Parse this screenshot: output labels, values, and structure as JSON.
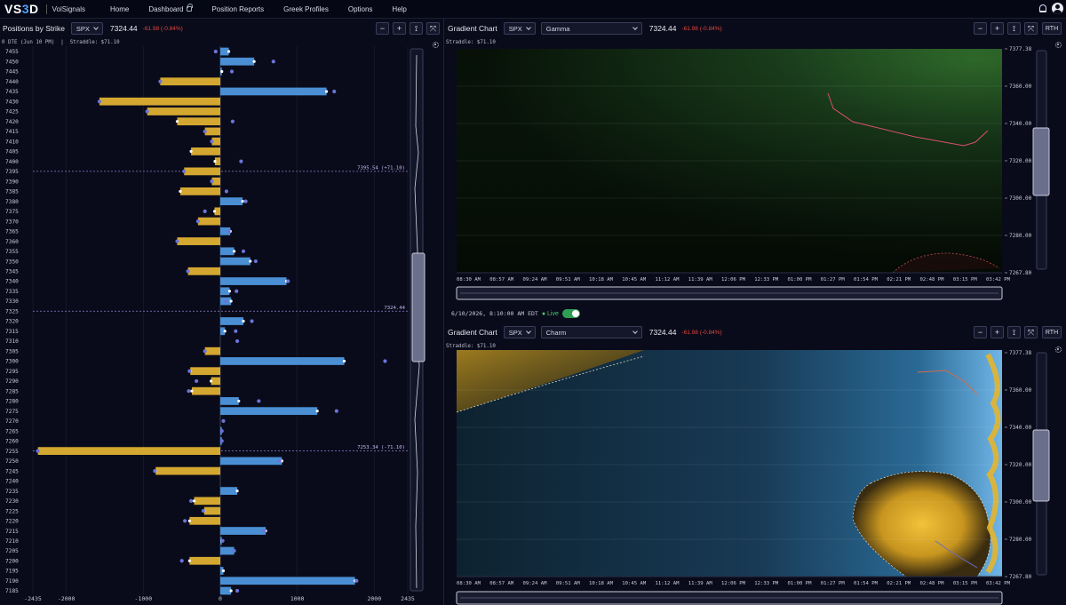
{
  "nav": {
    "logo_prefix": "VS",
    "logo_accent": "3",
    "logo_suffix": "D",
    "brand": "VolSignals",
    "links": [
      "Home",
      "Dashboard",
      "Position Reports",
      "Greek Profiles",
      "Options",
      "Help"
    ]
  },
  "left_panel": {
    "title": "Positions by Strike",
    "symbol": "SPX",
    "price": "7324.44",
    "change": "-61.98 (-0.84%)",
    "subtitle": "0 DTE (Jun 10 PM)  |  Straddle: $71.10",
    "buttons": [
      "−",
      "+",
      "⟟",
      "⤧"
    ]
  },
  "chart_data": {
    "type": "bar",
    "title": "",
    "x_ticks": [
      -2435,
      -2000,
      -1000,
      0,
      1000,
      2000,
      2435
    ],
    "xlim": [
      -2435,
      2435
    ],
    "ylim": [
      7185,
      7455
    ],
    "strike_step": 5,
    "annotations": [
      {
        "strike": 7395,
        "label": "7395.54 (+71.10)"
      },
      {
        "strike": 7325,
        "label": "7324.44"
      },
      {
        "strike": 7255,
        "label": "7253.34 (-71.10)"
      }
    ],
    "series": [
      {
        "name": "",
        "color": "#d4a830",
        "values": {
          "7440": -780,
          "7430": -1570,
          "7425": -950,
          "7420": -560,
          "7415": -200,
          "7410": -110,
          "7405": -380,
          "7400": -70,
          "7395": -470,
          "7390": -110,
          "7385": -520,
          "7375": -75,
          "7370": -290,
          "7360": -560,
          "7345": -420,
          "7305": -200,
          "7295": -390,
          "7290": -120,
          "7285": -370,
          "7255": -2370,
          "7245": -840,
          "7230": -340,
          "7225": -210,
          "7220": -400,
          "7200": -400
        }
      },
      {
        "name": "",
        "color": "#4a8fd4",
        "values": {
          "7455": 110,
          "7450": 440,
          "7445": 20,
          "7435": 1380,
          "7380": 290,
          "7365": 130,
          "7355": 180,
          "7350": 390,
          "7340": 860,
          "7335": 120,
          "7330": 140,
          "7320": 300,
          "7315": 60,
          "7300": 1610,
          "7280": 240,
          "7275": 1260,
          "7265": 20,
          "7260": 20,
          "7250": 800,
          "7235": 220,
          "7215": 590,
          "7210": 20,
          "7205": 180,
          "7195": 40,
          "7190": 1750,
          "7185": 140
        }
      }
    ],
    "dots": {
      "7455": -60,
      "7450": 690,
      "7445": 150,
      "7440": -780,
      "7435": 1480,
      "7430": -1570,
      "7425": -950,
      "7420": 160,
      "7415": -200,
      "7410": -110,
      "7400": 270,
      "7395": -470,
      "7390": -110,
      "7385": 80,
      "7380": 330,
      "7375": -200,
      "7370": -290,
      "7365": 110,
      "7360": -560,
      "7355": 300,
      "7350": 460,
      "7345": -420,
      "7340": 880,
      "7335": 210,
      "7330": 70,
      "7320": 410,
      "7315": 200,
      "7310": 220,
      "7305": -200,
      "7300": 2140,
      "7295": -400,
      "7290": -310,
      "7285": -410,
      "7280": 500,
      "7275": 1510,
      "7270": 40,
      "7265": 20,
      "7260": 20,
      "7255": -2370,
      "7250": 770,
      "7245": -850,
      "7230": -380,
      "7225": -220,
      "7220": -460,
      "7215": 570,
      "7210": 30,
      "7205": 180,
      "7200": -500,
      "7190": 1770,
      "7185": 220
    }
  },
  "gamma_panel": {
    "title": "Gradient Chart",
    "symbol": "SPX",
    "metric": "Gamma",
    "price": "7324.44",
    "change": "-61.98 (-0.84%)",
    "subtitle": "Straddle: $71.10",
    "rth": "RTH",
    "y_ticks": [
      "7377.38",
      "7360.00",
      "7340.00",
      "7320.00",
      "7300.00",
      "7280.00",
      "7267.80"
    ],
    "x_ticks": [
      "08:30 AM",
      "08:57 AM",
      "09:24 AM",
      "09:51 AM",
      "10:18 AM",
      "10:45 AM",
      "11:12 AM",
      "11:39 AM",
      "12:06 PM",
      "12:33 PM",
      "01:00 PM",
      "01:27 PM",
      "01:54 PM",
      "02:21 PM",
      "02:48 PM",
      "03:15 PM",
      "03:42 PM"
    ]
  },
  "status": {
    "timestamp": "6/10/2026, 8:10:00 AM EDT",
    "live_label": "Live"
  },
  "charm_panel": {
    "title": "Gradient Chart",
    "symbol": "SPX",
    "metric": "Charm",
    "price": "7324.44",
    "change": "-61.98 (-0.84%)",
    "subtitle": "Straddle: $71.10",
    "rth": "RTH",
    "y_ticks": [
      "7377.38",
      "7360.00",
      "7340.00",
      "7320.00",
      "7300.00",
      "7280.00",
      "7267.80"
    ],
    "x_ticks": [
      "08:30 AM",
      "08:57 AM",
      "09:24 AM",
      "09:51 AM",
      "10:18 AM",
      "10:45 AM",
      "11:12 AM",
      "11:39 AM",
      "12:06 PM",
      "12:33 PM",
      "01:00 PM",
      "01:27 PM",
      "01:54 PM",
      "02:21 PM",
      "02:48 PM",
      "03:15 PM",
      "03:42 PM"
    ]
  }
}
